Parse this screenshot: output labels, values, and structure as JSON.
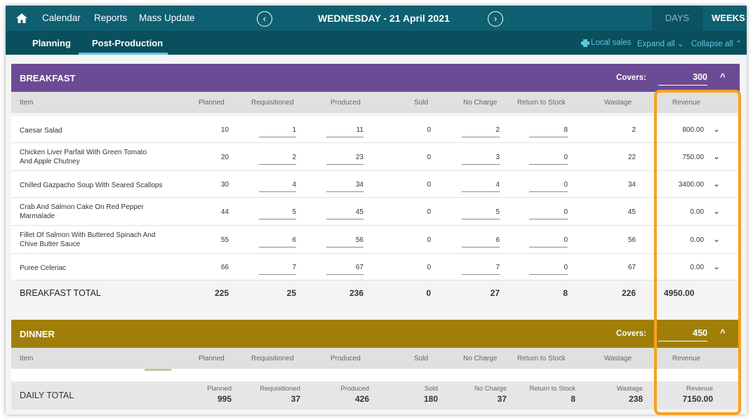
{
  "topnav": {
    "items": [
      "Calendar",
      "Reports",
      "Mass Update"
    ],
    "date": "WEDNESDAY - 21 April 2021",
    "prev_glyph": "‹",
    "next_glyph": "›",
    "days_label": "DAYS",
    "weeks_label": "WEEKS"
  },
  "subnav": {
    "tabs": [
      "Planning",
      "Post-Production"
    ],
    "active_tab": "Post-Production",
    "local_sales": "Local sales",
    "expand_all": "Expand all ⌄",
    "collapse_all": "Collapse all ⌃"
  },
  "columns": {
    "item": "Item",
    "planned": "Planned",
    "requisitioned": "Requisitioned",
    "produced": "Produced",
    "sold": "Sold",
    "no_charge": "No Charge",
    "return_to_stock": "Return to Stock",
    "wastage": "Wastage",
    "revenue": "Revenue"
  },
  "breakfast": {
    "name": "BREAKFAST",
    "covers_label": "Covers:",
    "covers": "300",
    "rows": [
      {
        "item": "Caesar Salad",
        "planned": "10",
        "requisitioned": "1",
        "produced": "11",
        "sold": "0",
        "no_charge": "2",
        "return_to_stock": "8",
        "wastage": "2",
        "revenue": "800.00"
      },
      {
        "item": "Chicken Liver Parfait With Green Tomato And Apple Chutney",
        "planned": "20",
        "requisitioned": "2",
        "produced": "23",
        "sold": "0",
        "no_charge": "3",
        "return_to_stock": "0",
        "wastage": "22",
        "revenue": "750.00"
      },
      {
        "item": "Chilled Gazpacho Soup With Seared Scallops",
        "planned": "30",
        "requisitioned": "4",
        "produced": "34",
        "sold": "0",
        "no_charge": "4",
        "return_to_stock": "0",
        "wastage": "34",
        "revenue": "3400.00"
      },
      {
        "item": "Crab And Salmon Cake On Red Pepper Marmalade",
        "planned": "44",
        "requisitioned": "5",
        "produced": "45",
        "sold": "0",
        "no_charge": "5",
        "return_to_stock": "0",
        "wastage": "45",
        "revenue": "0.00"
      },
      {
        "item": "Fillet Of Salmon With Buttered Spinach And Chive Butter Sauce",
        "planned": "55",
        "requisitioned": "6",
        "produced": "56",
        "sold": "0",
        "no_charge": "6",
        "return_to_stock": "0",
        "wastage": "56",
        "revenue": "0.00"
      },
      {
        "item": "Puree Celeriac",
        "planned": "66",
        "requisitioned": "7",
        "produced": "67",
        "sold": "0",
        "no_charge": "7",
        "return_to_stock": "0",
        "wastage": "67",
        "revenue": "0.00"
      }
    ],
    "total": {
      "label": "BREAKFAST TOTAL",
      "planned": "225",
      "requisitioned": "25",
      "produced": "236",
      "sold": "0",
      "no_charge": "27",
      "return_to_stock": "8",
      "wastage": "226",
      "revenue": "4950.00"
    }
  },
  "dinner": {
    "name": "DINNER",
    "covers_label": "Covers:",
    "covers": "450"
  },
  "daily_total": {
    "label": "DAILY TOTAL",
    "planned": "995",
    "requisitioned": "37",
    "produced": "426",
    "sold": "180",
    "no_charge": "37",
    "return_to_stock": "8",
    "wastage": "238",
    "revenue": "7150.00"
  },
  "colors": {
    "topbar": "#0e5f70",
    "subbar": "#0a4f5e",
    "breakfast": "#6b4b94",
    "dinner": "#a07f08",
    "highlight": "#f7a11e",
    "link": "#5fc6e0"
  }
}
